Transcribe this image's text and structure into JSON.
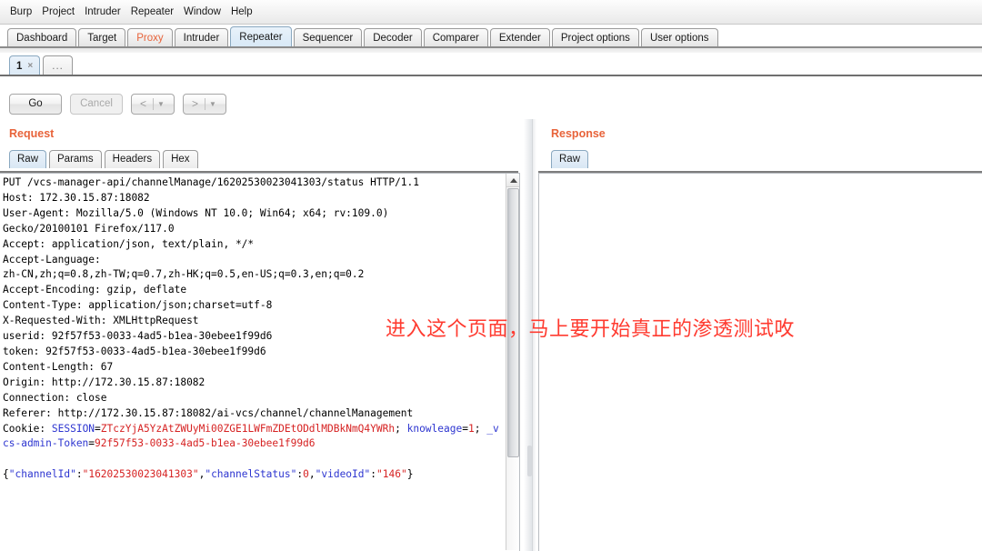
{
  "menu": {
    "items": [
      "Burp",
      "Project",
      "Intruder",
      "Repeater",
      "Window",
      "Help"
    ]
  },
  "main_tabs": [
    {
      "label": "Dashboard",
      "state": "normal"
    },
    {
      "label": "Target",
      "state": "normal"
    },
    {
      "label": "Proxy",
      "state": "accent"
    },
    {
      "label": "Intruder",
      "state": "normal"
    },
    {
      "label": "Repeater",
      "state": "selected"
    },
    {
      "label": "Sequencer",
      "state": "normal"
    },
    {
      "label": "Decoder",
      "state": "normal"
    },
    {
      "label": "Comparer",
      "state": "normal"
    },
    {
      "label": "Extender",
      "state": "normal"
    },
    {
      "label": "Project options",
      "state": "normal"
    },
    {
      "label": "User options",
      "state": "normal"
    }
  ],
  "sub_tabs": {
    "active": "1",
    "close_glyph": "×",
    "new_tab_label": "..."
  },
  "toolbar": {
    "go_label": "Go",
    "cancel_label": "Cancel",
    "back_arrow": "<",
    "forward_arrow": ">",
    "caret": "▼"
  },
  "request": {
    "title": "Request",
    "tabs": [
      "Raw",
      "Params",
      "Headers",
      "Hex"
    ],
    "active_tab": "Raw",
    "lines": [
      "PUT /vcs-manager-api/channelManage/16202530023041303/status HTTP/1.1",
      "Host: 172.30.15.87:18082",
      "User-Agent: Mozilla/5.0 (Windows NT 10.0; Win64; x64; rv:109.0)",
      "Gecko/20100101 Firefox/117.0",
      "Accept: application/json, text/plain, */*",
      "Accept-Language:",
      "zh-CN,zh;q=0.8,zh-TW;q=0.7,zh-HK;q=0.5,en-US;q=0.3,en;q=0.2",
      "Accept-Encoding: gzip, deflate",
      "Content-Type: application/json;charset=utf-8",
      "X-Requested-With: XMLHttpRequest",
      "userid: 92f57f53-0033-4ad5-b1ea-30ebee1f99d6",
      "token: 92f57f53-0033-4ad5-b1ea-30ebee1f99d6",
      "Content-Length: 67",
      "Origin: http://172.30.15.87:18082",
      "Connection: close",
      "Referer: http://172.30.15.87:18082/ai-vcs/channel/channelManagement"
    ],
    "cookie_label": "Cookie: ",
    "cookies": [
      {
        "name": "SESSION",
        "value": "ZTczYjA5YzAtZWUyMi00ZGE1LWFmZDEtODdlMDBkNmQ4YWRh",
        "trailer": "; "
      },
      {
        "name": "knowleage",
        "value": "1",
        "trailer": "; "
      },
      {
        "name": "_vcs-admin-Token",
        "value": "92f57f53-0033-4ad5-b1ea-30ebee1f99d6",
        "trailer": ""
      }
    ],
    "body_tokens": [
      {
        "text": "{",
        "kind": "plain"
      },
      {
        "text": "\"channelId\"",
        "kind": "key"
      },
      {
        "text": ":",
        "kind": "plain"
      },
      {
        "text": "\"16202530023041303\"",
        "kind": "value"
      },
      {
        "text": ",",
        "kind": "plain"
      },
      {
        "text": "\"channelStatus\"",
        "kind": "key"
      },
      {
        "text": ":",
        "kind": "plain"
      },
      {
        "text": "0",
        "kind": "value"
      },
      {
        "text": ",",
        "kind": "plain"
      },
      {
        "text": "\"videoId\"",
        "kind": "key"
      },
      {
        "text": ":",
        "kind": "plain"
      },
      {
        "text": "\"146\"",
        "kind": "value"
      },
      {
        "text": "}",
        "kind": "plain"
      }
    ]
  },
  "response": {
    "title": "Response",
    "tabs": [
      "Raw"
    ],
    "active_tab": "Raw",
    "body": ""
  },
  "annotation": {
    "text": "进入这个页面，马上要开始真正的渗透测试呚"
  },
  "colors": {
    "accent": "#e8633a",
    "annotation": "#ff3b30",
    "json_key": "#2d35d0",
    "json_value": "#d62222"
  }
}
